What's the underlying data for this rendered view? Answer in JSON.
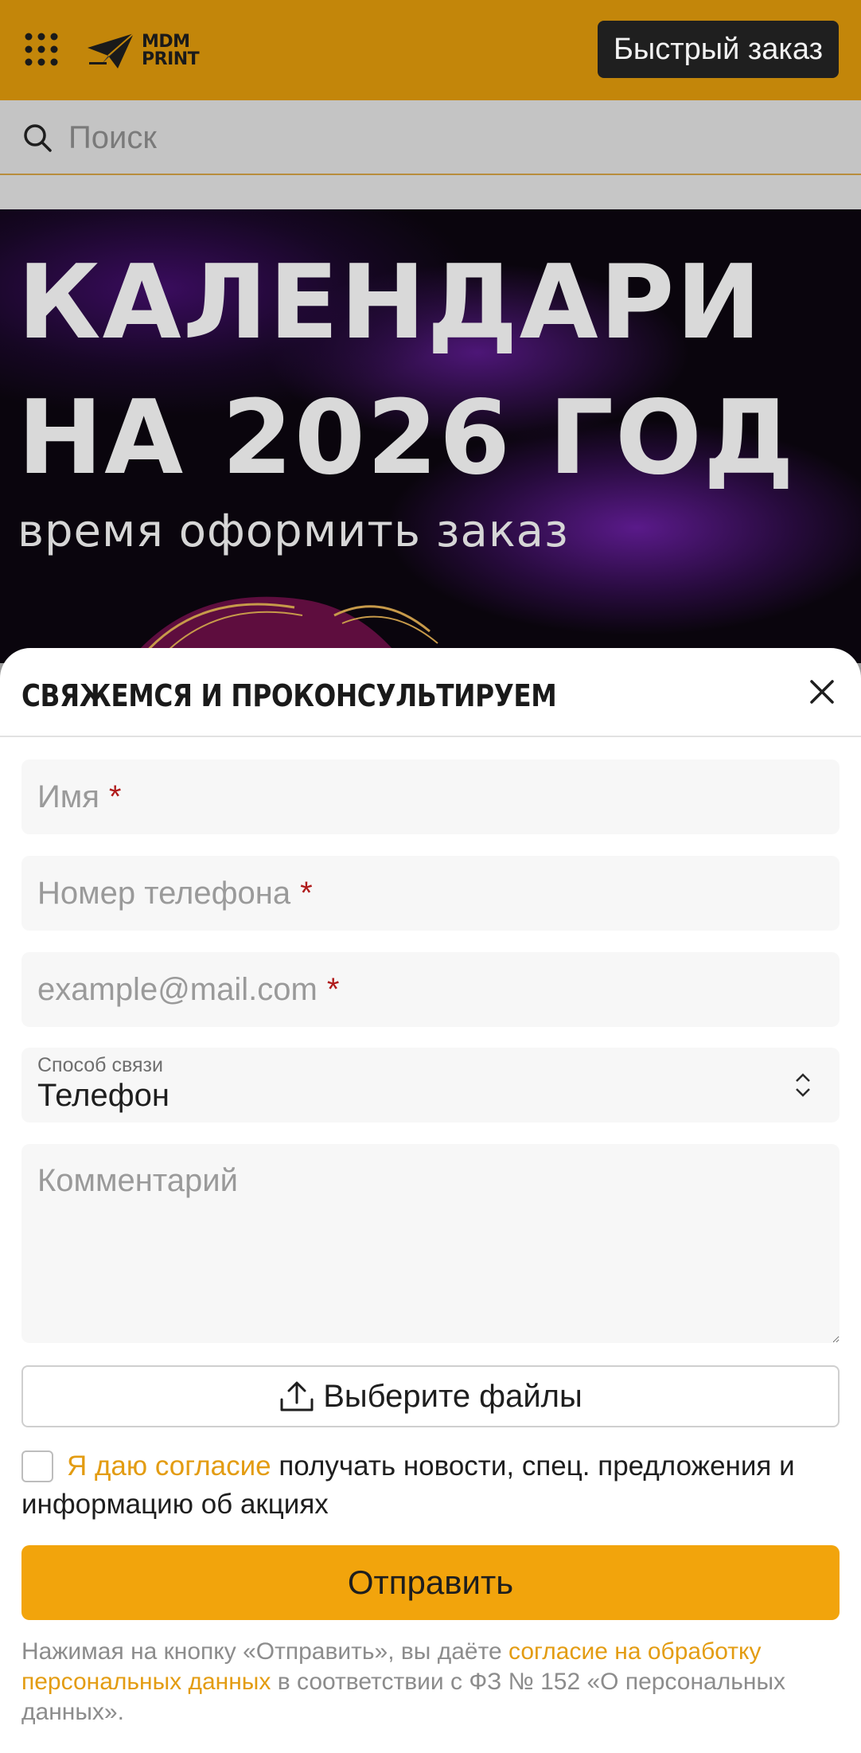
{
  "header": {
    "logo_line1": "MDM",
    "logo_line2": "PRINT",
    "quick_order_label": "Быстрый заказ"
  },
  "search": {
    "placeholder": "Поиск"
  },
  "banner": {
    "line1": "КАЛЕНДАРИ",
    "line2": "НА 2026 ГОД",
    "subtitle": "время оформить заказ"
  },
  "form": {
    "title": "СВЯЖЕМСЯ И ПРОКОНСУЛЬТИРУЕМ",
    "name_placeholder": "Имя",
    "phone_placeholder": "Номер телефона",
    "email_placeholder": "example@mail.com",
    "required_mark": "*",
    "contact_method_label": "Способ связи",
    "contact_method_value": "Телефон",
    "comment_placeholder": "Комментарий",
    "upload_label": "Выберите файлы",
    "consent_link": "Я даю согласие",
    "consent_text": " получать новости, спец. предложения и информацию об акциях",
    "submit_label": "Отправить",
    "legal_prefix": "Нажимая на кнопку «Отправить», вы даёте ",
    "legal_link": "согласие на обработку персональных данных",
    "legal_suffix": " в соответствии с ФЗ № 152 «О персональных данных»."
  },
  "colors": {
    "header_bg": "#c3860a",
    "accent": "#f2a40c",
    "link": "#e39c12",
    "required": "#b01c1c"
  }
}
